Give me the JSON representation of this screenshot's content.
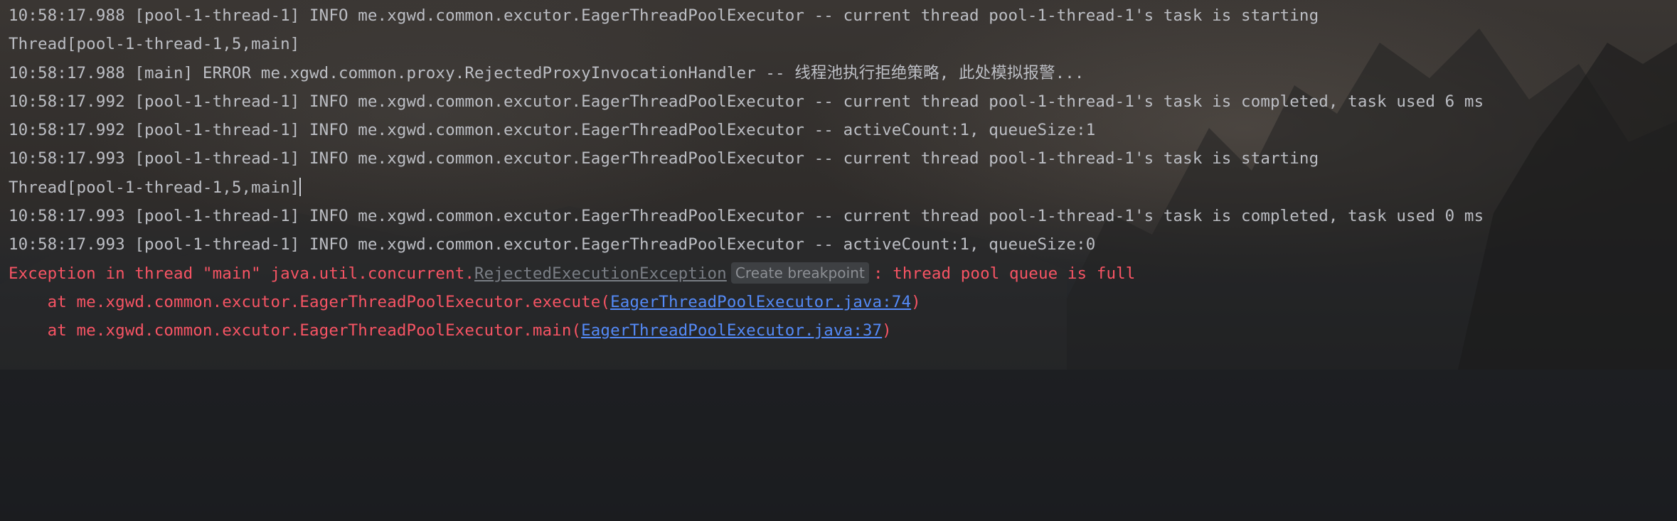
{
  "console": {
    "lines": [
      "10:58:17.988 [pool-1-thread-1] INFO me.xgwd.common.excutor.EagerThreadPoolExecutor -- current thread pool-1-thread-1's task is starting",
      "Thread[pool-1-thread-1,5,main]",
      "10:58:17.988 [main] ERROR me.xgwd.common.proxy.RejectedProxyInvocationHandler -- 线程池执行拒绝策略, 此处模拟报警...",
      "10:58:17.992 [pool-1-thread-1] INFO me.xgwd.common.excutor.EagerThreadPoolExecutor -- current thread pool-1-thread-1's task is completed, task used 6 ms",
      "10:58:17.992 [pool-1-thread-1] INFO me.xgwd.common.excutor.EagerThreadPoolExecutor -- activeCount:1, queueSize:1",
      "10:58:17.993 [pool-1-thread-1] INFO me.xgwd.common.excutor.EagerThreadPoolExecutor -- current thread pool-1-thread-1's task is starting",
      "Thread[pool-1-thread-1,5,main]",
      "10:58:17.993 [pool-1-thread-1] INFO me.xgwd.common.excutor.EagerThreadPoolExecutor -- current thread pool-1-thread-1's task is completed, task used 0 ms",
      "10:58:17.993 [pool-1-thread-1] INFO me.xgwd.common.excutor.EagerThreadPoolExecutor -- activeCount:1, queueSize:0"
    ],
    "exception": {
      "prefix": "Exception in thread \"main\" java.util.concurrent.",
      "class_name": "RejectedExecutionException",
      "breakpoint_hint": "Create breakpoint",
      "message": ": thread pool queue is full"
    },
    "stack": [
      {
        "prefix": "    at me.xgwd.common.excutor.EagerThreadPoolExecutor.execute(",
        "link": "EagerThreadPoolExecutor.java:74",
        "suffix": ")"
      },
      {
        "prefix": "    at me.xgwd.common.excutor.EagerThreadPoolExecutor.main(",
        "link": "EagerThreadPoolExecutor.java:37",
        "suffix": ")"
      }
    ]
  },
  "colors": {
    "log_text": "#bcbec4",
    "error_text": "#f75464",
    "link": "#548af7",
    "muted_class": "#7a7e85"
  }
}
